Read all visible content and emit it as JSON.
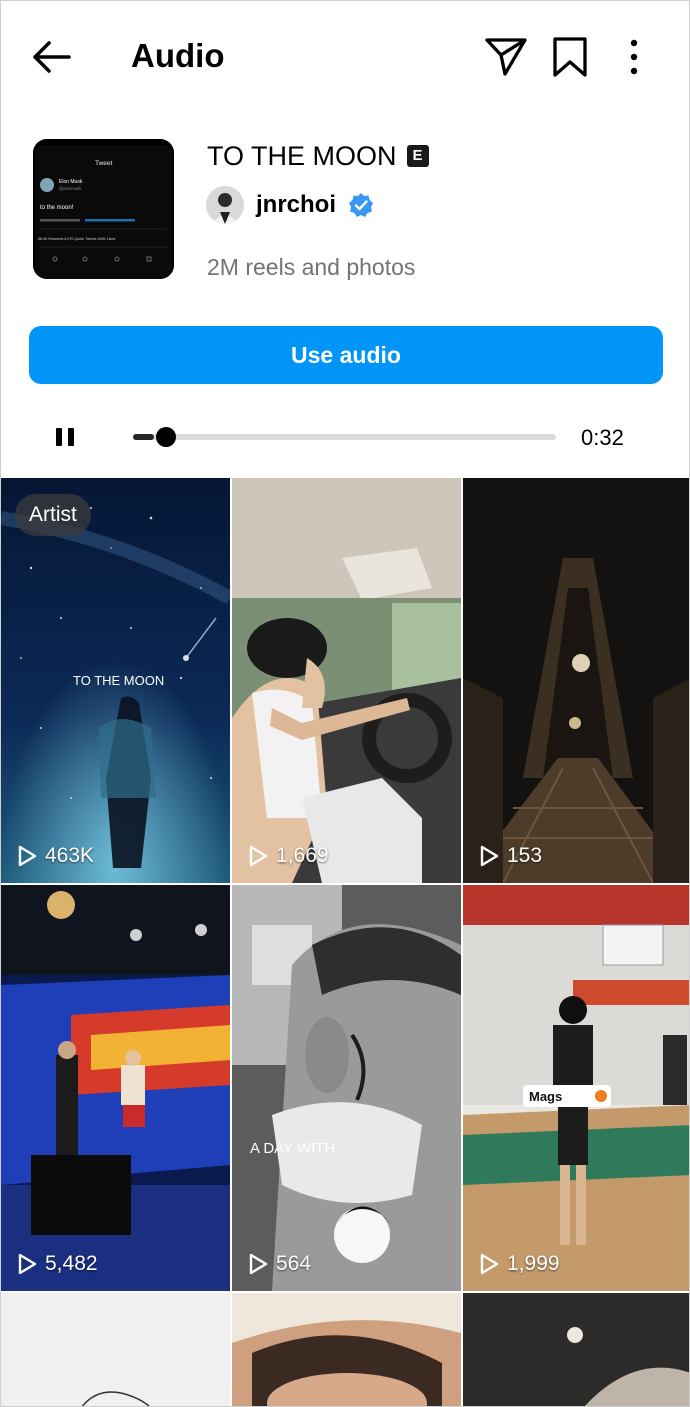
{
  "header": {
    "title": "Audio"
  },
  "audio": {
    "title": "TO THE MOON",
    "explicit_badge": "E",
    "artist": "jnrchoi",
    "reel_count": "2M reels and photos",
    "cover": {
      "app_title": "Tweet",
      "author": "Elon Musk",
      "handle": "@elonmusk",
      "text": "to the moon!",
      "stats": "68.4K Retweets  6,970 Quote Tweets  549K Likes"
    }
  },
  "use_audio_label": "Use audio",
  "player": {
    "time": "0:32",
    "progress": 0.05
  },
  "colors": {
    "accent": "#0095f6",
    "verified": "#3897f0"
  },
  "grid": {
    "artist_badge": "Artist",
    "tiles": [
      {
        "count": "463K",
        "overlay": "TO THE MOON"
      },
      {
        "count": "1,669"
      },
      {
        "count": "153"
      },
      {
        "count": "5,482"
      },
      {
        "count": "564",
        "overlay": "A DAY WITH"
      },
      {
        "count": "1,999",
        "overlay": "Mags"
      }
    ]
  }
}
